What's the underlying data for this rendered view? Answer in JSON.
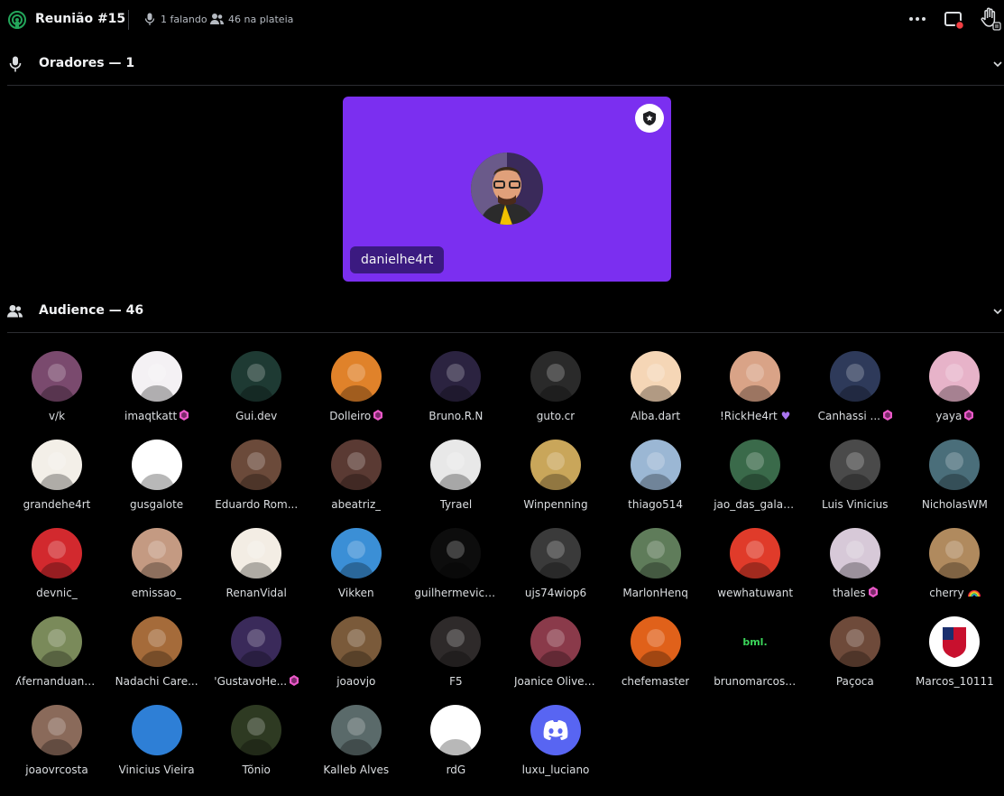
{
  "header": {
    "title": "Reunião #15",
    "speaking": "1 falando",
    "audience_count": "46 na plateia"
  },
  "speakers": {
    "heading": "Oradores — 1",
    "items": [
      {
        "name": "danielhe4rt"
      }
    ]
  },
  "audience": {
    "heading": "Audience — 46",
    "members": [
      {
        "name": "v/k",
        "badge": "",
        "color": "#7a4a6e"
      },
      {
        "name": "imaqtkatt",
        "badge": "boost",
        "color": "#f4f1f4"
      },
      {
        "name": "Gui.dev",
        "badge": "",
        "color": "#1e3a33"
      },
      {
        "name": "Dolleiro",
        "badge": "boost",
        "color": "#e0822a"
      },
      {
        "name": "Bruno.R.N",
        "badge": "",
        "color": "#2b2340"
      },
      {
        "name": "guto.cr",
        "badge": "",
        "color": "#2a2a2a"
      },
      {
        "name": "Alba.dart",
        "badge": "",
        "color": "#f5d6b6"
      },
      {
        "name": "!RickHe4rt",
        "badge": "heart",
        "color": "#d9a387"
      },
      {
        "name": "Canhassi ...",
        "badge": "boost",
        "color": "#2e3a5a"
      },
      {
        "name": "yaya",
        "badge": "boost",
        "color": "#e7b3c9"
      },
      {
        "name": "grandehe4rt",
        "badge": "",
        "color": "#f3efe8"
      },
      {
        "name": "gusgalote",
        "badge": "",
        "color": "#ffffff"
      },
      {
        "name": "Eduardo Rom...",
        "badge": "",
        "color": "#6b4a3a"
      },
      {
        "name": "abeatriz_",
        "badge": "",
        "color": "#5a3a33"
      },
      {
        "name": "Tyrael",
        "badge": "",
        "color": "#e8e8e8"
      },
      {
        "name": "Winpenning",
        "badge": "",
        "color": "#c9a65a"
      },
      {
        "name": "thiago514",
        "badge": "",
        "color": "#9bb7d4"
      },
      {
        "name": "jao_das_galax...",
        "badge": "",
        "color": "#3a6a4a"
      },
      {
        "name": "Luis Vinicius",
        "badge": "",
        "color": "#4a4a4a"
      },
      {
        "name": "NicholasWM",
        "badge": "",
        "color": "#4a6e7a"
      },
      {
        "name": "devnic_",
        "badge": "",
        "color": "#d2292e"
      },
      {
        "name": "emissao_",
        "badge": "",
        "color": "#c49a82"
      },
      {
        "name": "RenanVidal",
        "badge": "",
        "color": "#f3ede4"
      },
      {
        "name": "Vikken",
        "badge": "",
        "color": "#3b8fd6"
      },
      {
        "name": "guilhermevictor",
        "badge": "",
        "color": "#0d0d0d"
      },
      {
        "name": "ujs74wiop6",
        "badge": "",
        "color": "#3a3a3a"
      },
      {
        "name": "MarlonHenq",
        "badge": "",
        "color": "#5f7c5a"
      },
      {
        "name": "wewhatuwant",
        "badge": "",
        "color": "#e03b2a"
      },
      {
        "name": "thales",
        "badge": "boost",
        "color": "#d7c9d8"
      },
      {
        "name": "cherry",
        "badge": "rainbow",
        "color": "#b08a5e"
      },
      {
        "name": "ʎfernanduand...",
        "badge": "",
        "color": "#7a8a5a"
      },
      {
        "name": "Nadachi Care...",
        "badge": "",
        "color": "#a56b3a"
      },
      {
        "name": "'GustavoHe...",
        "badge": "boost",
        "color": "#3a2a5a"
      },
      {
        "name": "joaovjo",
        "badge": "",
        "color": "#7a5a3a"
      },
      {
        "name": "F5",
        "badge": "",
        "color": "#2e2a2a"
      },
      {
        "name": "Joanice Olivei...",
        "badge": "",
        "color": "#8a3a4a"
      },
      {
        "name": "chefemaster",
        "badge": "",
        "color": "#e0611a"
      },
      {
        "name": "brunomarcosl...",
        "badge": "",
        "color": "#000000"
      },
      {
        "name": "Paçoca",
        "badge": "",
        "color": "#6e4a3a"
      },
      {
        "name": "Marcos_10111",
        "badge": "",
        "color": "#ffffff"
      },
      {
        "name": "joaovrcosta",
        "badge": "",
        "color": "#8a6a5a"
      },
      {
        "name": "Vinicius Vieira",
        "badge": "",
        "color": "#2e7fd6"
      },
      {
        "name": "Tõnio",
        "badge": "",
        "color": "#2e3a22"
      },
      {
        "name": "Kalleb Alves",
        "badge": "",
        "color": "#5a6a6a"
      },
      {
        "name": "rdG",
        "badge": "",
        "color": "#ffffff"
      },
      {
        "name": "luxu_luciano",
        "badge": "",
        "color": "#5865f2"
      }
    ],
    "logo_text": "bml."
  },
  "colors": {
    "tile": "#7b2ff0",
    "boost": "#eb59c9",
    "discord": "#5865f2",
    "live": "#23a55a"
  }
}
